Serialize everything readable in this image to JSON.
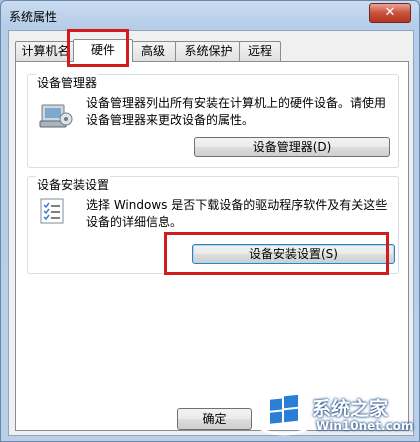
{
  "window": {
    "title": "系统属性",
    "close_glyph": "✕"
  },
  "tabs": [
    {
      "label": "计算机名"
    },
    {
      "label": "硬件"
    },
    {
      "label": "高级"
    },
    {
      "label": "系统保护"
    },
    {
      "label": "远程"
    }
  ],
  "active_tab": "硬件",
  "device_manager": {
    "title": "设备管理器",
    "description": "设备管理器列出所有安装在计算机上的硬件设备。请使用设备管理器来更改设备的属性。",
    "button_label": "设备管理器(D)"
  },
  "device_install": {
    "title": "设备安装设置",
    "description": "选择 Windows 是否下载设备的驱动程序软件及有关这些设备的详细信息。",
    "button_label": "设备安装设置(S)"
  },
  "footer": {
    "ok_label": "确定"
  },
  "watermark": {
    "brand": "系统之家",
    "url": "Win10net.com"
  },
  "colors": {
    "highlight": "#d01c1c",
    "title_bar": "#b9cfe9"
  }
}
